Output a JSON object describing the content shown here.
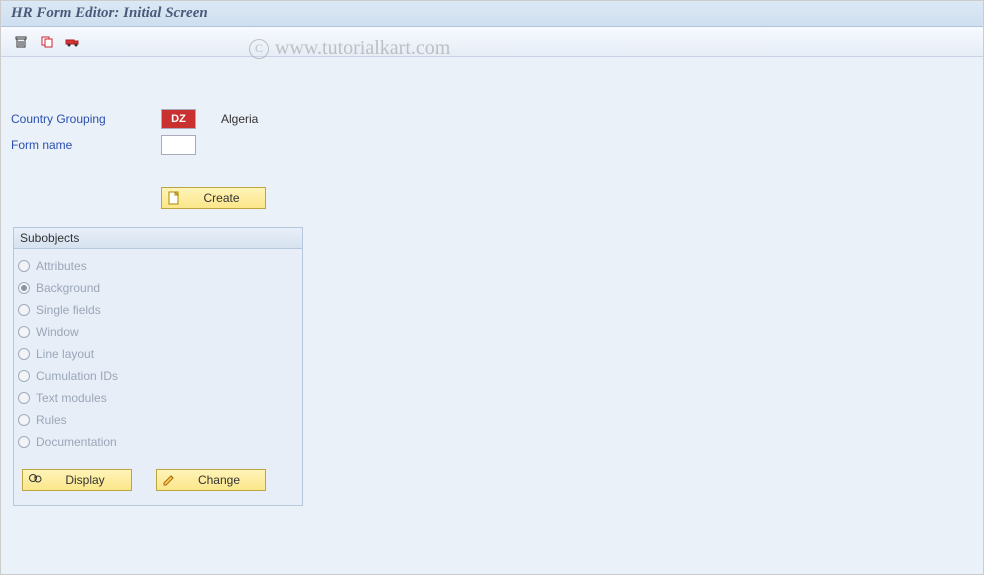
{
  "title": "HR Form Editor: Initial Screen",
  "watermark": "www.tutorialkart.com",
  "form": {
    "country_label": "Country Grouping",
    "country_code": "DZ",
    "country_name": "Algeria",
    "form_name_label": "Form name",
    "form_name_value": ""
  },
  "buttons": {
    "create": "Create",
    "display": "Display",
    "change": "Change"
  },
  "subobjects": {
    "title": "Subobjects",
    "selected": "Background",
    "items": [
      "Attributes",
      "Background",
      "Single fields",
      "Window",
      "Line layout",
      "Cumulation IDs",
      "Text modules",
      "Rules",
      "Documentation"
    ]
  }
}
